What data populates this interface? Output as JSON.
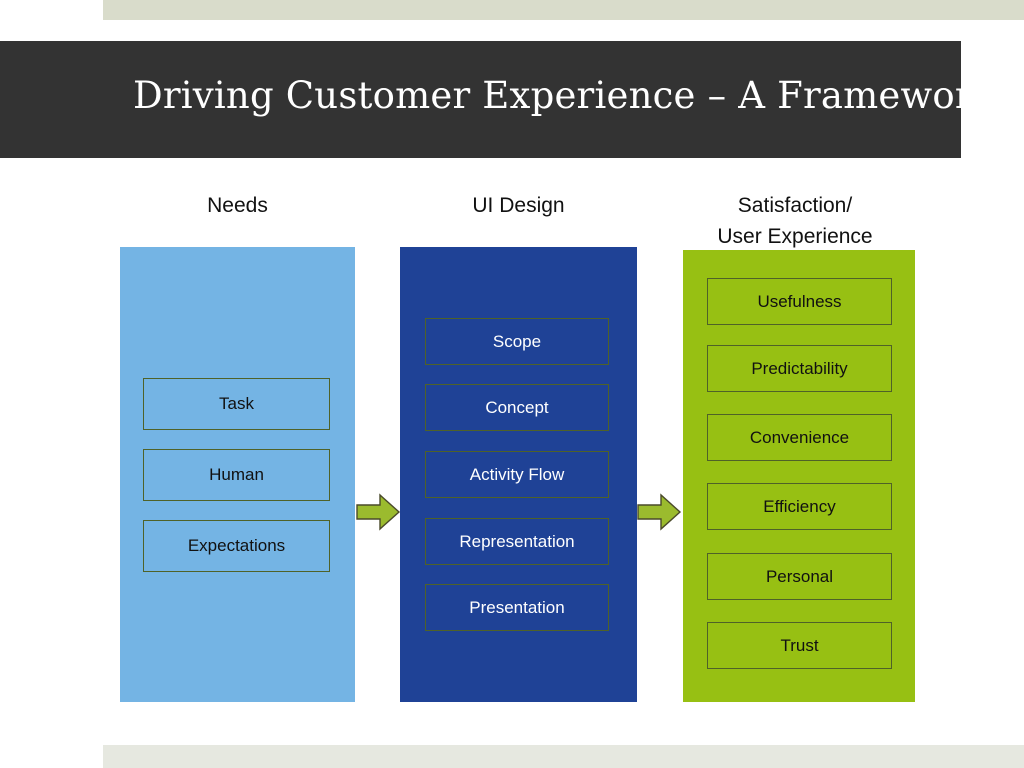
{
  "slide": {
    "title": "Driving Customer Experience – A Framework",
    "title_bar_color": "#333333",
    "accent_bar_color": "#d9dccb"
  },
  "columns": [
    {
      "id": "needs",
      "header_lines": [
        "Needs"
      ],
      "fill_color": "#74b4e4",
      "text_color": "#111111",
      "items": [
        {
          "label": "Task"
        },
        {
          "label": "Human"
        },
        {
          "label": "Expectations"
        }
      ]
    },
    {
      "id": "uidesign",
      "header_lines": [
        "UI Design"
      ],
      "fill_color": "#1f4296",
      "text_color": "#ffffff",
      "items": [
        {
          "label": "Scope"
        },
        {
          "label": "Concept"
        },
        {
          "label": "Activity Flow"
        },
        {
          "label": "Representation"
        },
        {
          "label": "Presentation"
        }
      ]
    },
    {
      "id": "satisfaction",
      "header_lines": [
        "Satisfaction/",
        "User Experience"
      ],
      "fill_color": "#97c013",
      "text_color": "#111111",
      "items": [
        {
          "label": "Usefulness"
        },
        {
          "label": "Predictability"
        },
        {
          "label": "Convenience"
        },
        {
          "label": "Efficiency"
        },
        {
          "label": "Personal"
        },
        {
          "label": "Trust"
        }
      ]
    }
  ],
  "arrows": [
    {
      "id": "needs-to-uidesign",
      "direction": "right",
      "color": "#9bbb2e"
    },
    {
      "id": "uidesign-to-satisfaction",
      "direction": "right",
      "color": "#9bbb2e"
    }
  ]
}
